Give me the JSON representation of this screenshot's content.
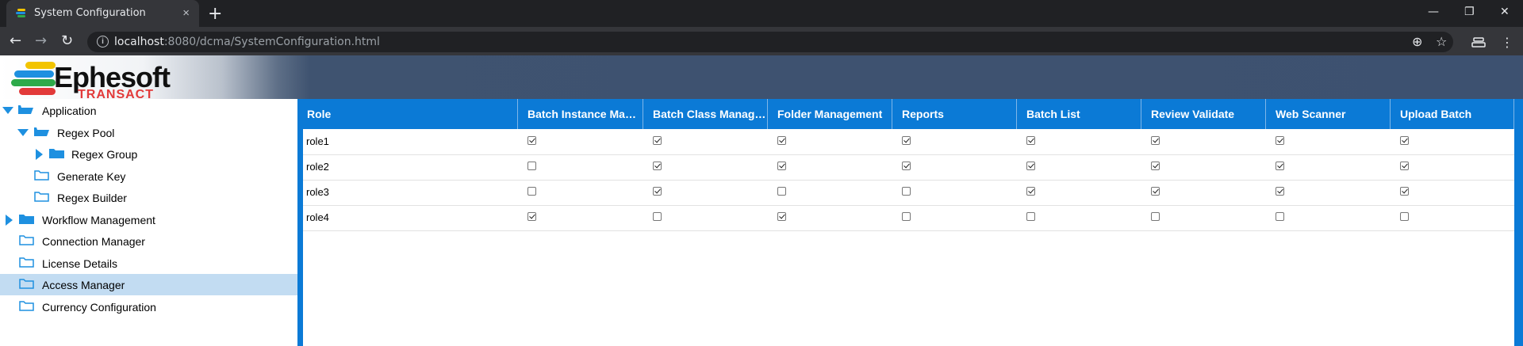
{
  "browser": {
    "tab_title": "System Configuration",
    "tab_close": "×",
    "new_tab": "+",
    "url_host": "localhost",
    "url_rest": ":8080/dcma/SystemConfiguration.html",
    "back": "←",
    "forward": "→",
    "reload": "↻",
    "minimize": "—",
    "restore": "❐",
    "close": "✕",
    "zoom_icon": "⊕",
    "star_icon": "☆",
    "menu_icon": "⋮"
  },
  "logo": {
    "word": "Ephesoft",
    "sub": "TRANSACT"
  },
  "tree": {
    "items": [
      {
        "label": "Application"
      },
      {
        "label": "Regex Pool"
      },
      {
        "label": "Regex Group"
      },
      {
        "label": "Generate Key"
      },
      {
        "label": "Regex Builder"
      },
      {
        "label": "Workflow Management"
      },
      {
        "label": "Connection Manager"
      },
      {
        "label": "License Details"
      },
      {
        "label": "Access Manager"
      },
      {
        "label": "Currency Configuration"
      }
    ]
  },
  "grid": {
    "columns": [
      "Role",
      "Batch Instance Management",
      "Batch Class Management",
      "Folder Management",
      "Reports",
      "Batch List",
      "Review Validate",
      "Web Scanner",
      "Upload Batch"
    ],
    "rows": [
      {
        "role": "role1",
        "checks": [
          true,
          true,
          true,
          true,
          true,
          true,
          true,
          true
        ]
      },
      {
        "role": "role2",
        "checks": [
          false,
          true,
          true,
          true,
          true,
          true,
          true,
          true
        ]
      },
      {
        "role": "role3",
        "checks": [
          false,
          true,
          false,
          false,
          true,
          true,
          true,
          true
        ]
      },
      {
        "role": "role4",
        "checks": [
          true,
          false,
          true,
          false,
          false,
          false,
          false,
          false
        ]
      }
    ]
  },
  "colors": {
    "accent": "#0b7ad6",
    "selected_row": "#c2dcf2",
    "folder_blue": "#1e90e0"
  }
}
